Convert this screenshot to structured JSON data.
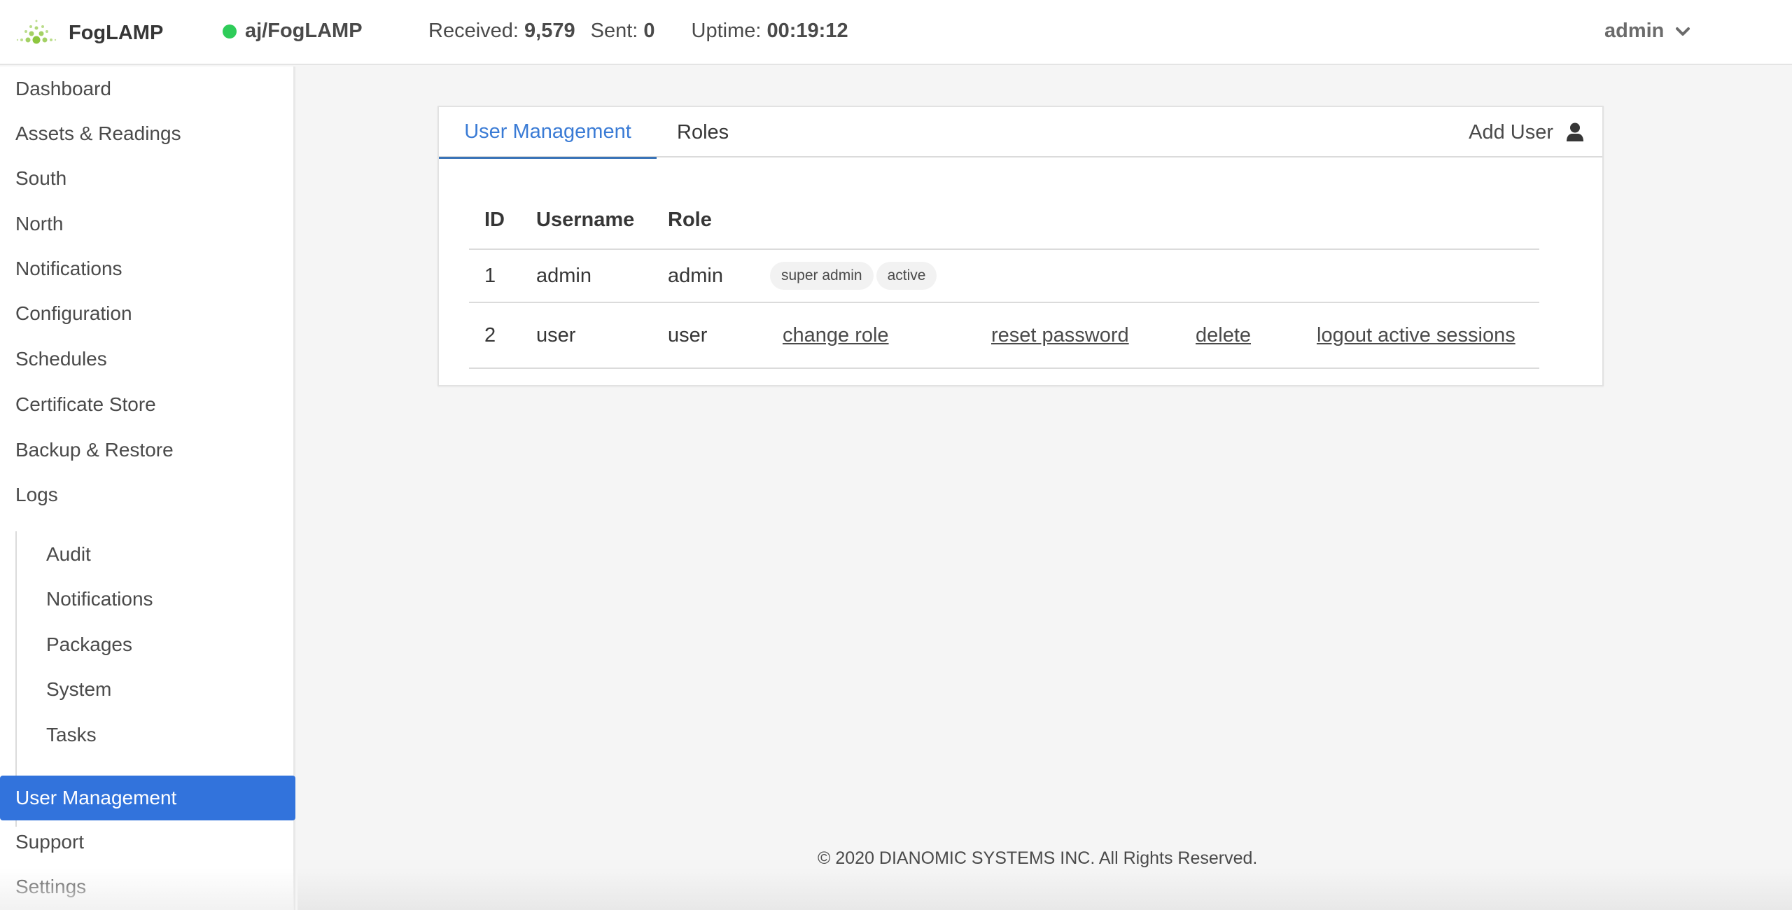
{
  "header": {
    "brand": "FogLAMP",
    "instance": {
      "name": "aj/FogLAMP",
      "status": "running",
      "status_color": "#2ecc59"
    },
    "stats": {
      "received_label": "Received:",
      "received_value": "9,579",
      "sent_label": "Sent:",
      "sent_value": "0",
      "uptime_label": "Uptime:",
      "uptime_value": "00:19:12"
    },
    "user_menu": {
      "label": "admin",
      "icon": "chevron-down-icon"
    }
  },
  "sidebar": {
    "items": [
      {
        "label": "Dashboard"
      },
      {
        "label": "Assets & Readings"
      },
      {
        "label": "South"
      },
      {
        "label": "North"
      },
      {
        "label": "Notifications"
      },
      {
        "label": "Configuration"
      },
      {
        "label": "Schedules"
      },
      {
        "label": "Certificate Store"
      },
      {
        "label": "Backup & Restore"
      },
      {
        "label": "Logs"
      }
    ],
    "logs_sub": [
      {
        "label": "Audit"
      },
      {
        "label": "Notifications"
      },
      {
        "label": "Packages"
      },
      {
        "label": "System"
      },
      {
        "label": "Tasks"
      }
    ],
    "bottom_items": [
      {
        "label": "User Management",
        "active": true
      },
      {
        "label": "Support"
      },
      {
        "label": "Settings"
      }
    ],
    "accent_color": "#3273dc"
  },
  "main": {
    "tabs": [
      {
        "label": "User Management",
        "active": true
      },
      {
        "label": "Roles",
        "active": false
      }
    ],
    "add_user": {
      "label": "Add User",
      "icon": "user-icon"
    },
    "table": {
      "headers": [
        "ID",
        "Username",
        "Role"
      ],
      "rows": [
        {
          "id": "1",
          "username": "admin",
          "role": "admin",
          "tags": [
            "super admin",
            "active"
          ]
        },
        {
          "id": "2",
          "username": "user",
          "role": "user",
          "actions": [
            "change role",
            "reset password",
            "delete",
            "logout active sessions"
          ]
        }
      ]
    }
  },
  "footer": {
    "text": "© 2020 DIANOMIC SYSTEMS INC. All Rights Reserved."
  }
}
